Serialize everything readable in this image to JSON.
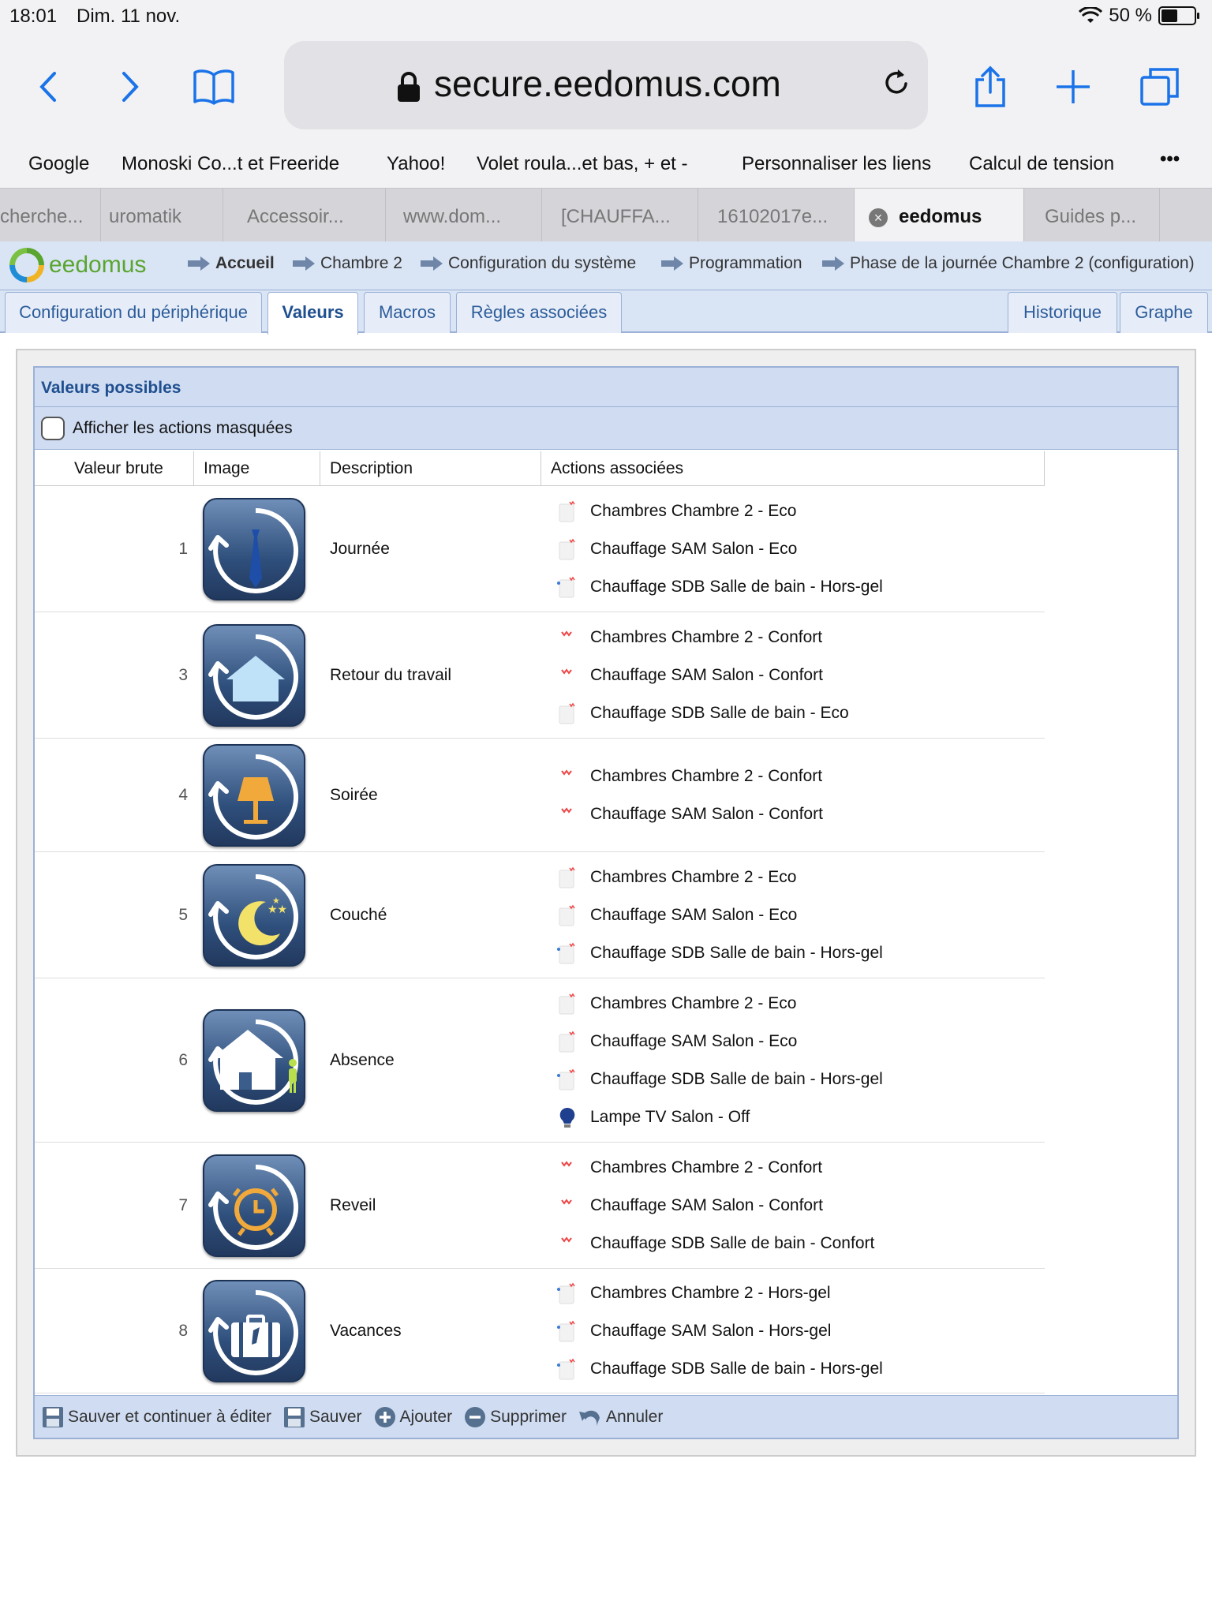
{
  "status": {
    "time": "18:01",
    "date": "Dim. 11 nov.",
    "battery": "50 %"
  },
  "address": {
    "url": "secure.eedomus.com"
  },
  "bookmarks": [
    "Google",
    "Monoski Co...t et Freeride",
    "Yahoo!",
    "Volet roula...et bas, + et -",
    "Personnaliser les liens",
    "Calcul de tension",
    "•••"
  ],
  "tabs": [
    "cherche...",
    "uromatik",
    "Accessoir...",
    "www.dom...",
    "[CHAUFFA...",
    "16102017e...",
    "eedomus",
    "Guides p..."
  ],
  "eedomus": {
    "logo": "eedomus",
    "breadcrumb": [
      "Accueil",
      "Chambre 2",
      "Configuration du système",
      "Programmation",
      "Phase de la journée Chambre 2 (configuration)"
    ]
  },
  "subtabs": {
    "left": [
      "Configuration du périphérique",
      "Valeurs",
      "Macros",
      "Règles associées"
    ],
    "right": [
      "Historique",
      "Graphe"
    ]
  },
  "box": {
    "title": "Valeurs possibles",
    "checkbox_label": "Afficher les actions masquées",
    "columns": [
      "Valeur brute",
      "Image",
      "Description",
      "Actions associées"
    ]
  },
  "rows": [
    {
      "raw": "1",
      "icon": "tie-icon",
      "description": "Journée",
      "actions": [
        {
          "icon": "heater-eco-icon",
          "text": "Chambres Chambre 2 - Eco"
        },
        {
          "icon": "heater-eco-icon",
          "text": "Chauffage SAM Salon - Eco"
        },
        {
          "icon": "heater-frost-icon",
          "text": "Chauffage SDB Salle de bain - Hors-gel"
        }
      ]
    },
    {
      "raw": "3",
      "icon": "house-icon",
      "description": "Retour du travail",
      "actions": [
        {
          "icon": "heater-comfort-icon",
          "text": "Chambres Chambre 2 - Confort"
        },
        {
          "icon": "heater-comfort-icon",
          "text": "Chauffage SAM Salon - Confort"
        },
        {
          "icon": "heater-eco-icon",
          "text": "Chauffage SDB Salle de bain - Eco"
        }
      ]
    },
    {
      "raw": "4",
      "icon": "lamp-icon",
      "description": "Soirée",
      "actions": [
        {
          "icon": "heater-comfort-icon",
          "text": "Chambres Chambre 2 - Confort"
        },
        {
          "icon": "heater-comfort-icon",
          "text": "Chauffage SAM Salon - Confort"
        }
      ]
    },
    {
      "raw": "5",
      "icon": "moon-icon",
      "description": "Couché",
      "actions": [
        {
          "icon": "heater-eco-icon",
          "text": "Chambres Chambre 2 - Eco"
        },
        {
          "icon": "heater-eco-icon",
          "text": "Chauffage SAM Salon - Eco"
        },
        {
          "icon": "heater-frost-icon",
          "text": "Chauffage SDB Salle de bain - Hors-gel"
        }
      ]
    },
    {
      "raw": "6",
      "icon": "house-away-icon",
      "description": "Absence",
      "actions": [
        {
          "icon": "heater-eco-icon",
          "text": "Chambres Chambre 2 - Eco"
        },
        {
          "icon": "heater-eco-icon",
          "text": "Chauffage SAM Salon - Eco"
        },
        {
          "icon": "heater-frost-icon",
          "text": "Chauffage SDB Salle de bain - Hors-gel"
        },
        {
          "icon": "bulb-icon",
          "text": "Lampe TV Salon - Off"
        }
      ]
    },
    {
      "raw": "7",
      "icon": "alarm-clock-icon",
      "description": "Reveil",
      "actions": [
        {
          "icon": "heater-comfort-icon",
          "text": "Chambres Chambre 2 - Confort"
        },
        {
          "icon": "heater-comfort-icon",
          "text": "Chauffage SAM Salon - Confort"
        },
        {
          "icon": "heater-comfort-icon",
          "text": "Chauffage SDB Salle de bain - Confort"
        }
      ]
    },
    {
      "raw": "8",
      "icon": "suitcase-icon",
      "description": "Vacances",
      "actions": [
        {
          "icon": "heater-frost-icon",
          "text": "Chambres Chambre 2 - Hors-gel"
        },
        {
          "icon": "heater-frost-icon",
          "text": "Chauffage SAM Salon - Hors-gel"
        },
        {
          "icon": "heater-frost-icon",
          "text": "Chauffage SDB Salle de bain - Hors-gel"
        }
      ]
    }
  ],
  "footer": [
    "Sauver et continuer à éditer",
    "Sauver",
    "Ajouter",
    "Supprimer",
    "Annuler"
  ],
  "colors": {
    "accent": "#1a73e8",
    "header_bg": "#d9e4f5",
    "box_bg": "#cfdcf2",
    "link": "#2c5c9a"
  }
}
